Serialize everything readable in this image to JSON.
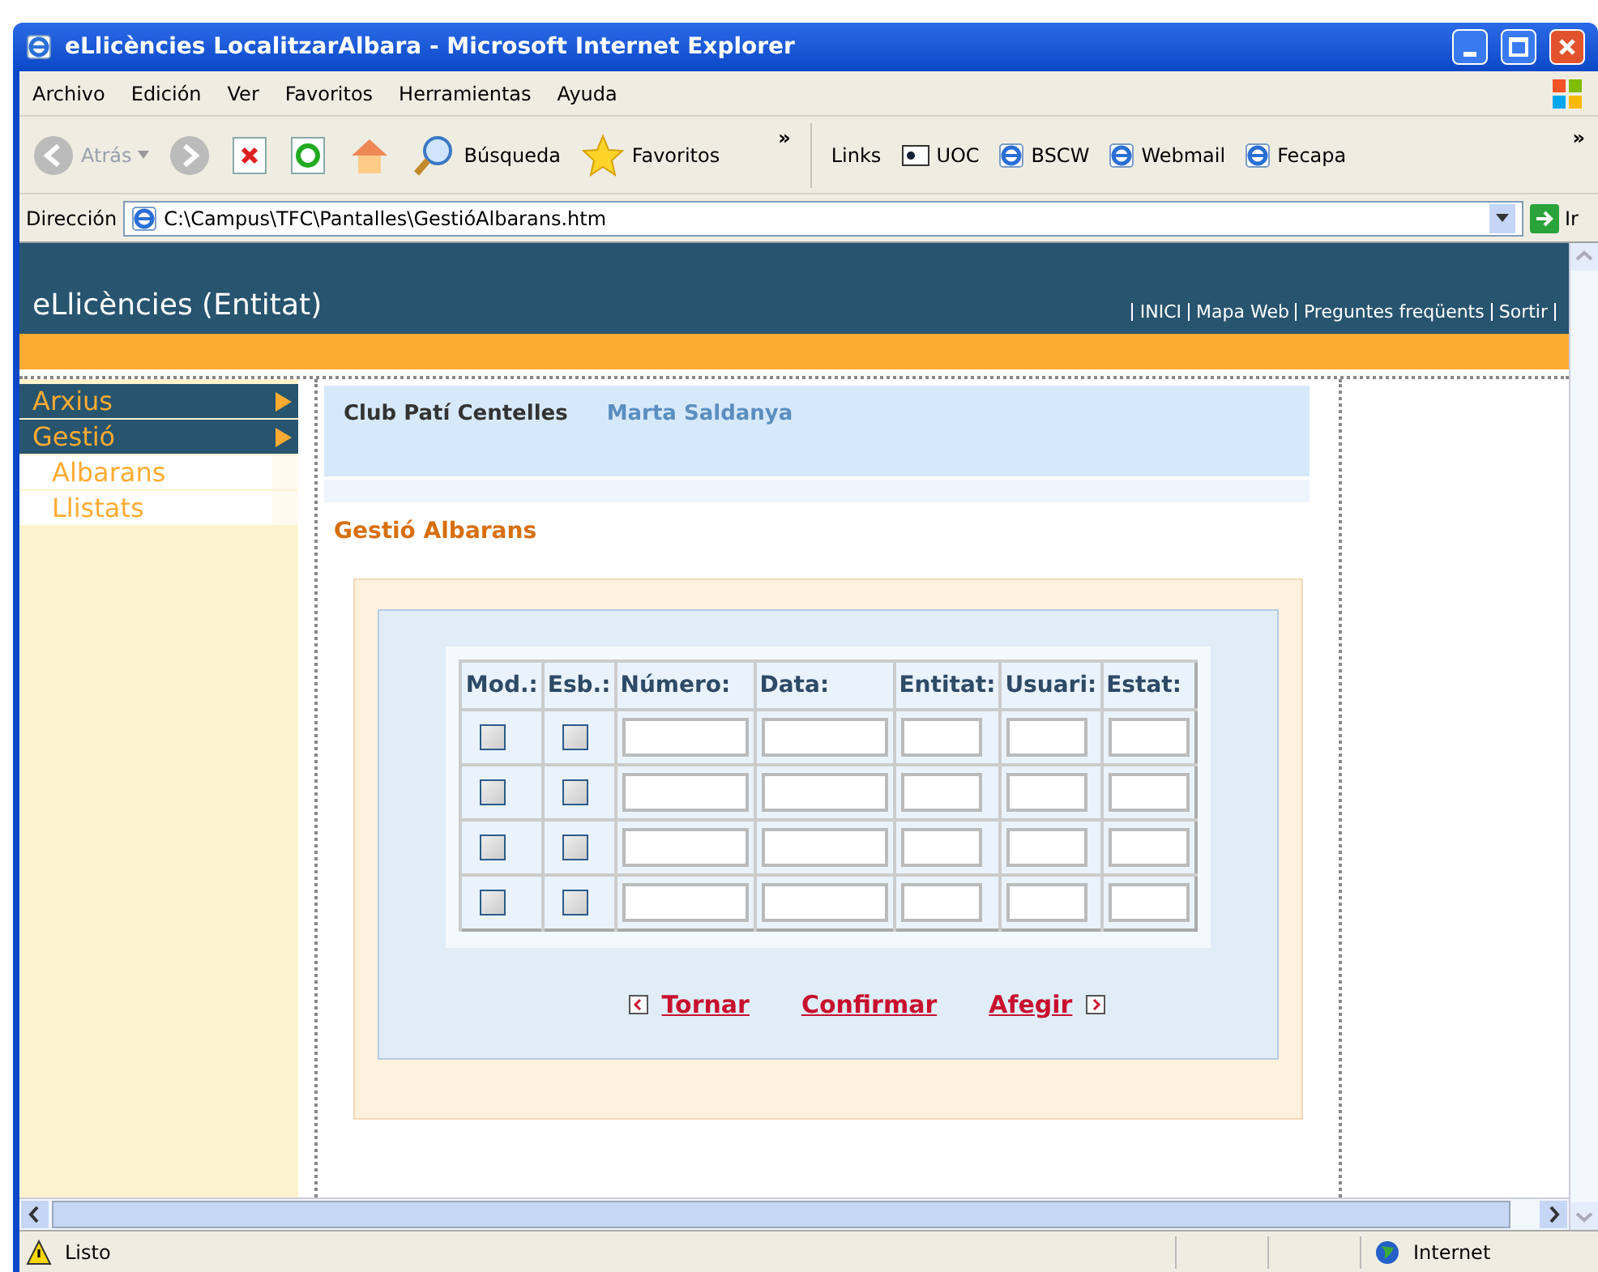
{
  "window": {
    "title": "eLlicències LocalitzarAlbara - Microsoft Internet Explorer"
  },
  "menu": [
    "Archivo",
    "Edición",
    "Ver",
    "Favoritos",
    "Herramientas",
    "Ayuda"
  ],
  "toolbar": {
    "back": "Atrás",
    "search": "Búsqueda",
    "favorites": "Favoritos",
    "chevron": "»",
    "links_label": "Links",
    "links": [
      "UOC",
      "BSCW",
      "Webmail",
      "Fecapa"
    ],
    "links_chevron": "»"
  },
  "address": {
    "label": "Dirección",
    "value": "C:\\Campus\\TFC\\Pantalles\\GestióAlbarans.htm",
    "go": "Ir"
  },
  "site": {
    "title": "eLlicències (Entitat)",
    "nav": [
      "INICI",
      "Mapa Web",
      "Preguntes freqüents",
      "Sortir"
    ]
  },
  "sidebar": [
    {
      "label": "Arxius",
      "kind": "menu"
    },
    {
      "label": "Gestió",
      "kind": "menu"
    },
    {
      "label": "Albarans",
      "kind": "submenu"
    },
    {
      "label": "Llistats",
      "kind": "submenu"
    }
  ],
  "info": {
    "entity": "Club Patí Centelles",
    "user": "Marta Saldanya"
  },
  "heading": "Gestió Albarans",
  "table": {
    "columns": [
      "Mod.:",
      "Esb.:",
      "Número:",
      "Data:",
      "Entitat:",
      "Usuari:",
      "Estat:"
    ],
    "rows": [
      {
        "modify": false,
        "delete": false
      },
      {
        "modify": false,
        "delete": false
      },
      {
        "modify": false,
        "delete": false
      },
      {
        "modify": false,
        "delete": false
      }
    ]
  },
  "actions": [
    "Tornar",
    "Confirmar",
    "Afegir"
  ],
  "status_bar": {
    "text": "Listo",
    "zone": "Internet"
  }
}
